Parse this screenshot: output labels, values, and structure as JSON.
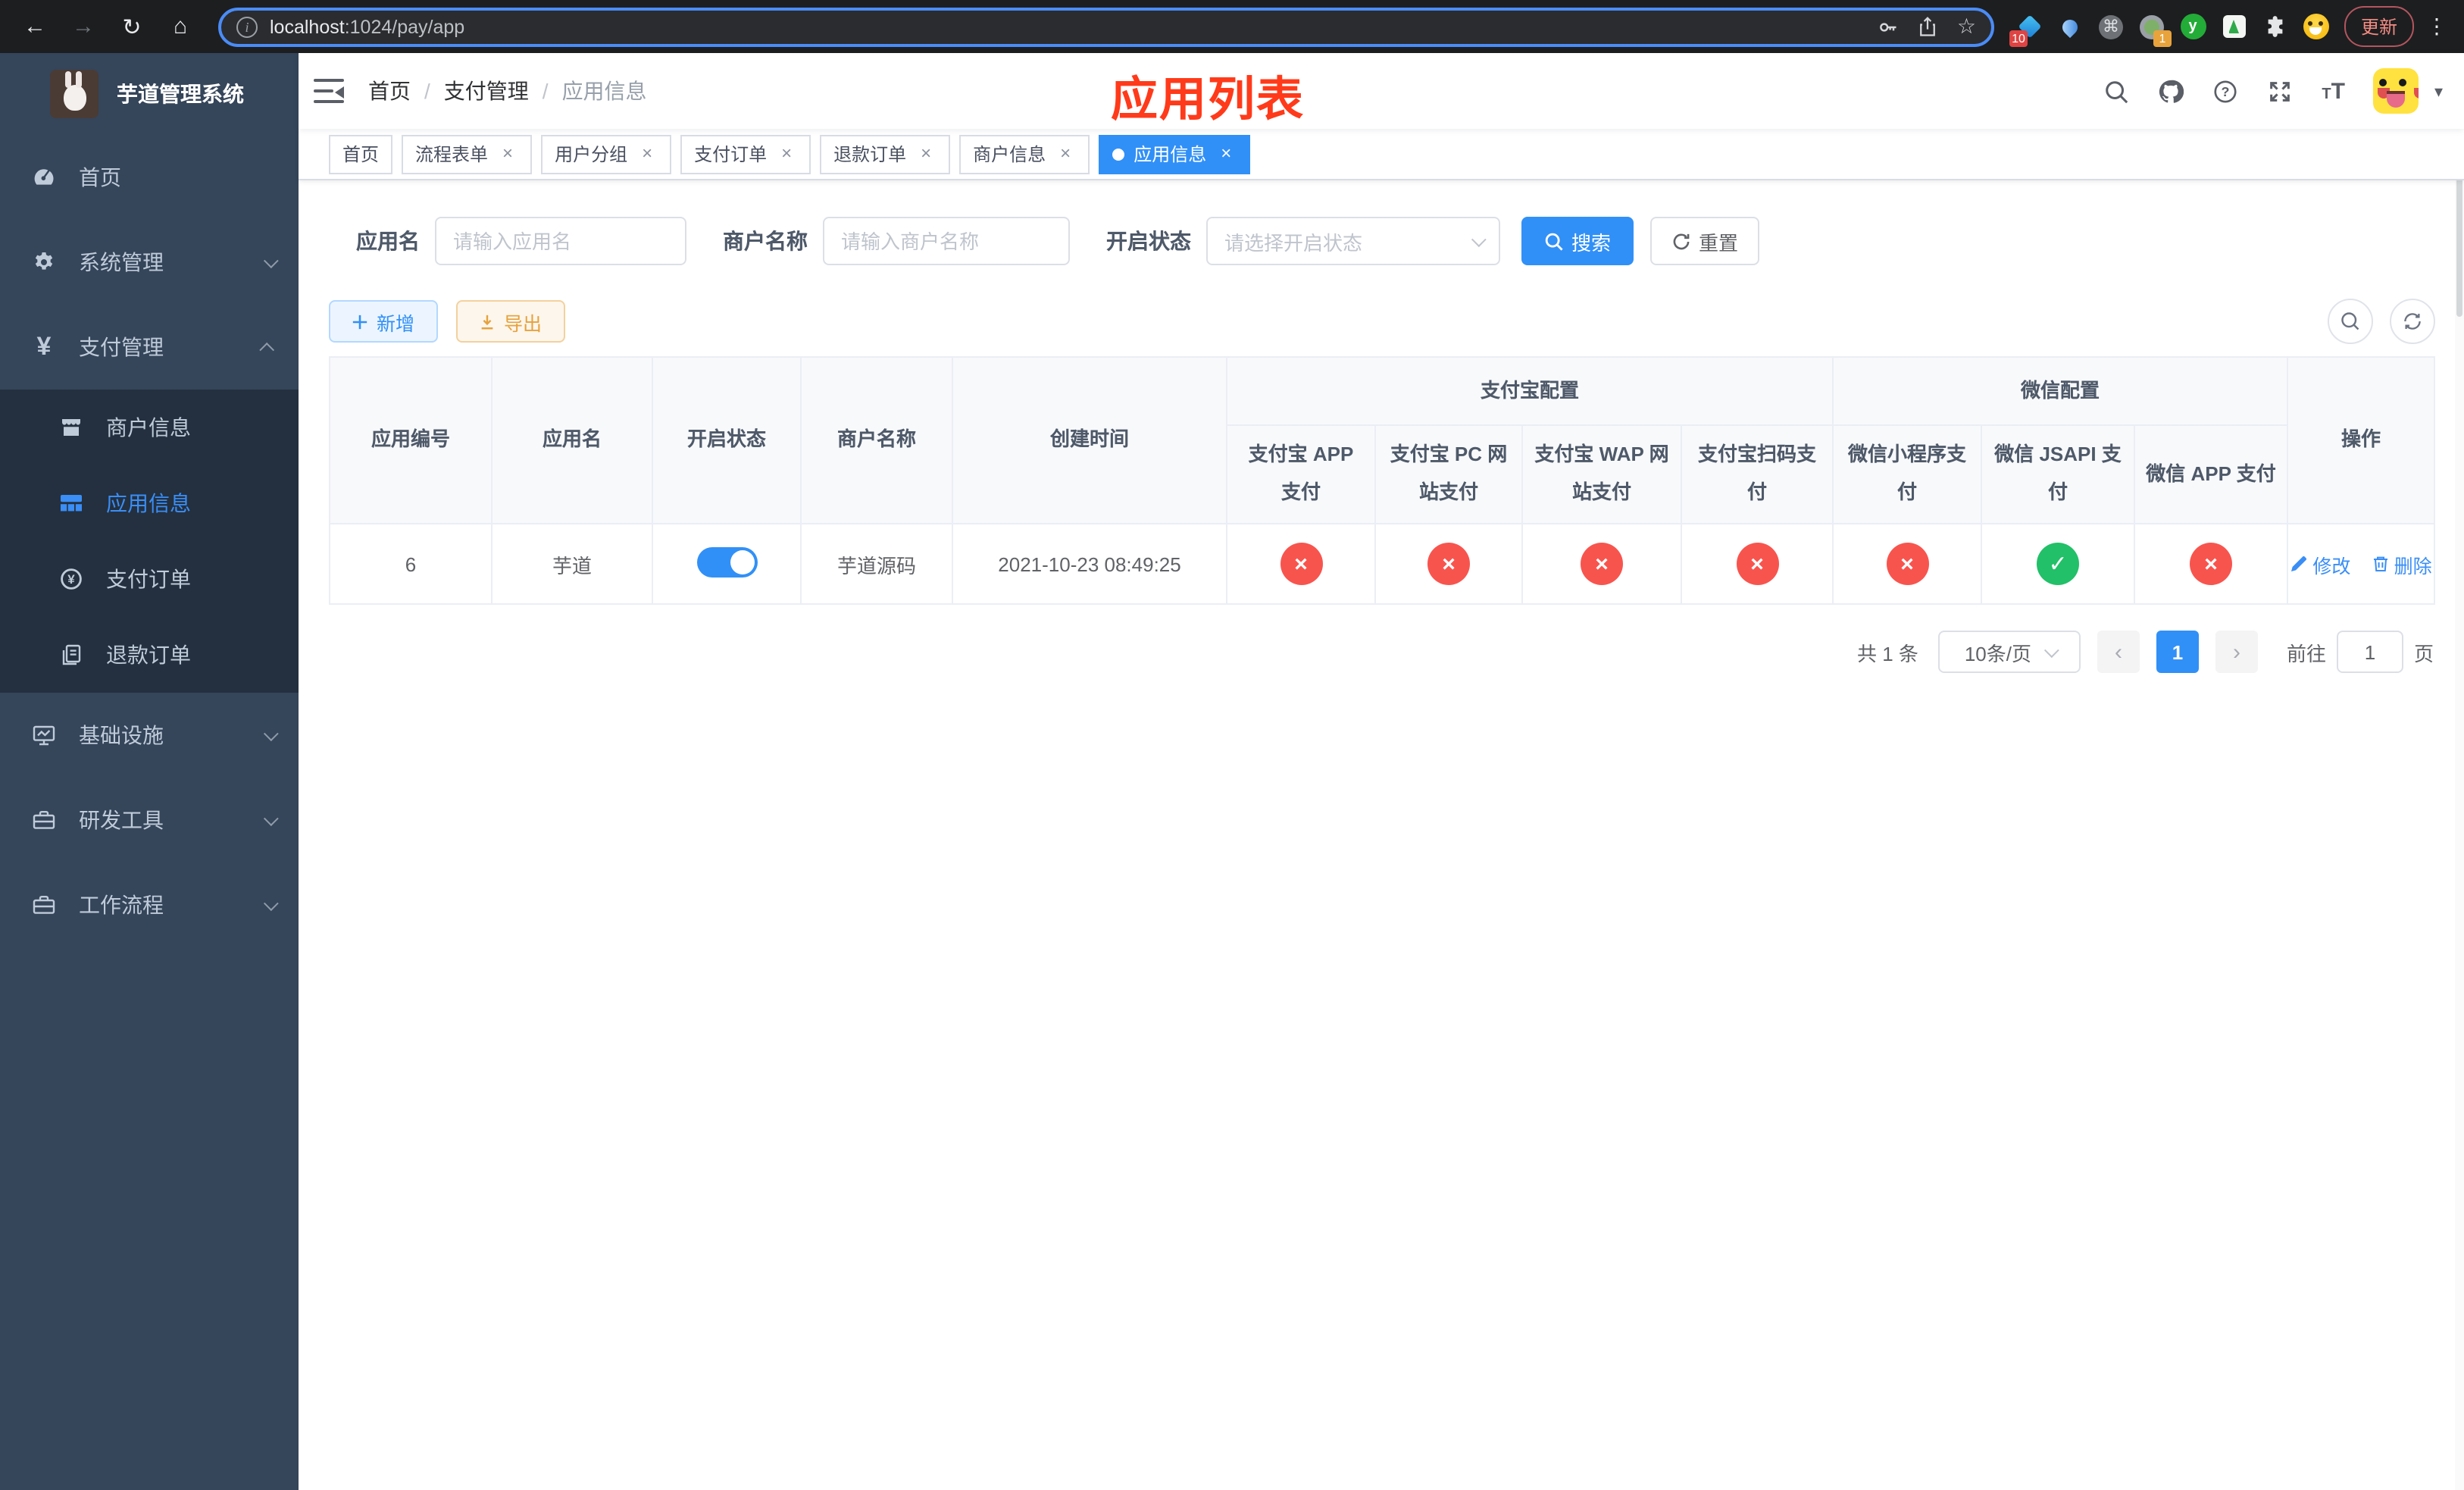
{
  "browser": {
    "url_host": "localhost",
    "url_rest": ":1024/pay/app",
    "ext_badge_blue": "10",
    "ext_badge_orange": "1",
    "ext_green_letter": "y",
    "update_label": "更新"
  },
  "sidebar": {
    "title": "芋道管理系统",
    "menu": [
      {
        "label": "首页",
        "icon": "dashboard-icon"
      },
      {
        "label": "系统管理",
        "icon": "gear-icon"
      },
      {
        "label": "支付管理",
        "icon": "yen-icon"
      },
      {
        "label": "基础设施",
        "icon": "monitor-icon"
      },
      {
        "label": "研发工具",
        "icon": "toolbox-icon"
      },
      {
        "label": "工作流程",
        "icon": "toolbox-icon"
      }
    ],
    "submenu": [
      {
        "label": "商户信息",
        "icon": "store-icon"
      },
      {
        "label": "应用信息",
        "icon": "grid-icon"
      },
      {
        "label": "支付订单",
        "icon": "yen-circle-icon"
      },
      {
        "label": "退款订单",
        "icon": "documents-icon"
      }
    ]
  },
  "header": {
    "breadcrumb": [
      "首页",
      "支付管理",
      "应用信息"
    ],
    "annotation": "应用列表"
  },
  "tabs": [
    {
      "label": "首页"
    },
    {
      "label": "流程表单"
    },
    {
      "label": "用户分组"
    },
    {
      "label": "支付订单"
    },
    {
      "label": "退款订单"
    },
    {
      "label": "商户信息"
    },
    {
      "label": "应用信息"
    }
  ],
  "filters": {
    "app_name_label": "应用名",
    "app_name_placeholder": "请输入应用名",
    "merchant_label": "商户名称",
    "merchant_placeholder": "请输入商户名称",
    "status_label": "开启状态",
    "status_placeholder": "请选择开启状态",
    "search_label": "搜索",
    "reset_label": "重置"
  },
  "toolbar": {
    "add_label": "新增",
    "export_label": "导出"
  },
  "table": {
    "columns_simple": [
      "应用编号",
      "应用名",
      "开启状态",
      "商户名称",
      "创建时间"
    ],
    "group_alipay": "支付宝配置",
    "group_wechat": "微信配置",
    "pay_columns": [
      "支付宝 APP 支付",
      "支付宝 PC 网站支付",
      "支付宝 WAP 网站支付",
      "支付宝扫码支付",
      "微信小程序支付",
      "微信 JSAPI 支付",
      "微信 APP 支付"
    ],
    "ops_header": "操作",
    "row": {
      "id": "6",
      "name": "芋道",
      "enabled": true,
      "merchant": "芋道源码",
      "created": "2021-10-23 08:49:25",
      "statuses": [
        "fail",
        "fail",
        "fail",
        "fail",
        "fail",
        "success",
        "fail"
      ],
      "edit_label": "修改",
      "delete_label": "删除"
    }
  },
  "pagination": {
    "total": "共 1 条",
    "page_size": "10条/页",
    "current_page": "1",
    "goto_label": "前往",
    "goto_value": "1",
    "page_unit": "页"
  },
  "colors": {
    "primary": "#3190f7",
    "success": "#22c068",
    "danger": "#f8544e",
    "warning": "#e6a23c",
    "annotation_red": "#ff3a1a",
    "sidebar_bg": "#35455a",
    "submenu_bg": "#24303f"
  }
}
